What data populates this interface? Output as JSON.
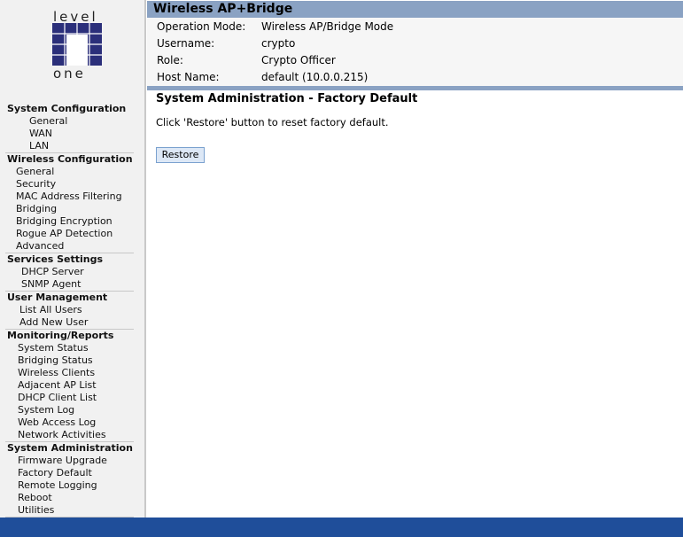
{
  "logo": {
    "top_text": "level",
    "bottom_text": "one",
    "mark_color": "#2b2f7a"
  },
  "header": {
    "title": "Wireless AP+Bridge"
  },
  "info": [
    {
      "label": "Operation Mode:",
      "value": "Wireless AP/Bridge Mode"
    },
    {
      "label": "Username:",
      "value": "crypto"
    },
    {
      "label": "Role:",
      "value": "Crypto Officer"
    },
    {
      "label": "Host Name:",
      "value": "default (10.0.0.215)"
    }
  ],
  "main": {
    "title": "System Administration - Factory Default",
    "description": "Click 'Restore' button to reset factory default.",
    "restore_label": "Restore"
  },
  "nav": [
    {
      "title": "System Configuration",
      "items": [
        "General",
        "WAN",
        "LAN"
      ]
    },
    {
      "title": "Wireless Configuration",
      "items": [
        "General",
        "Security",
        "MAC Address Filtering",
        "Bridging",
        "Bridging Encryption",
        "Rogue AP Detection",
        "Advanced"
      ]
    },
    {
      "title": "Services Settings",
      "items": [
        "DHCP Server",
        "SNMP Agent"
      ]
    },
    {
      "title": "User Management",
      "items": [
        "List All Users",
        "Add New User"
      ]
    },
    {
      "title": "Monitoring/Reports",
      "items": [
        "System Status",
        "Bridging Status",
        "Wireless Clients",
        "Adjacent AP List",
        "DHCP Client List",
        "System Log",
        "Web Access Log",
        "Network Activities"
      ]
    },
    {
      "title": "System Administration",
      "items": [
        "Firmware Upgrade",
        "Factory Default",
        "Remote Logging",
        "Reboot",
        "Utilities"
      ]
    }
  ],
  "colors": {
    "header_bar": "#8aa2c3",
    "footer_bar": "#1f4e9a",
    "sidebar_bg": "#f1f1f1"
  }
}
